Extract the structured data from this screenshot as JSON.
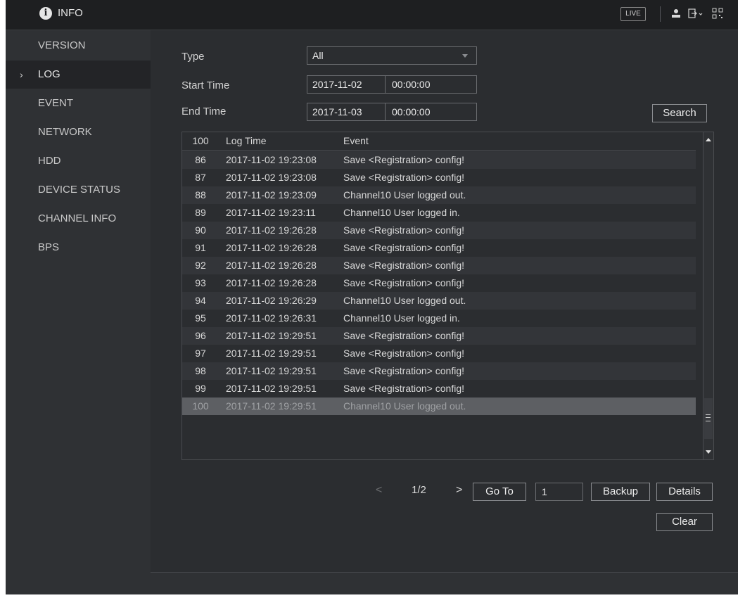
{
  "header": {
    "title": "INFO",
    "live_label": "LIVE"
  },
  "sidebar": {
    "items": [
      {
        "label": "VERSION"
      },
      {
        "label": "LOG"
      },
      {
        "label": "EVENT"
      },
      {
        "label": "NETWORK"
      },
      {
        "label": "HDD"
      },
      {
        "label": "DEVICE STATUS"
      },
      {
        "label": "CHANNEL INFO"
      },
      {
        "label": "BPS"
      }
    ],
    "active_chevron": "›"
  },
  "filters": {
    "type_label": "Type",
    "type_value": "All",
    "start_label": "Start Time",
    "start_date": "2017-11-02",
    "start_time": "00:00:00",
    "end_label": "End Time",
    "end_date": "2017-11-03",
    "end_time": "00:00:00",
    "search_label": "Search"
  },
  "table": {
    "header": {
      "num": "100",
      "time": "Log Time",
      "event": "Event"
    },
    "rows": [
      {
        "num": "86",
        "time": "2017-11-02 19:23:08",
        "event": "Save <Registration> config!"
      },
      {
        "num": "87",
        "time": "2017-11-02 19:23:08",
        "event": "Save <Registration> config!"
      },
      {
        "num": "88",
        "time": "2017-11-02 19:23:09",
        "event": "Channel10  User logged out."
      },
      {
        "num": "89",
        "time": "2017-11-02 19:23:11",
        "event": "Channel10  User logged in."
      },
      {
        "num": "90",
        "time": "2017-11-02 19:26:28",
        "event": "Save <Registration> config!"
      },
      {
        "num": "91",
        "time": "2017-11-02 19:26:28",
        "event": "Save <Registration> config!"
      },
      {
        "num": "92",
        "time": "2017-11-02 19:26:28",
        "event": "Save <Registration> config!"
      },
      {
        "num": "93",
        "time": "2017-11-02 19:26:28",
        "event": "Save <Registration> config!"
      },
      {
        "num": "94",
        "time": "2017-11-02 19:26:29",
        "event": "Channel10  User logged out."
      },
      {
        "num": "95",
        "time": "2017-11-02 19:26:31",
        "event": "Channel10  User logged in."
      },
      {
        "num": "96",
        "time": "2017-11-02 19:29:51",
        "event": "Save <Registration> config!"
      },
      {
        "num": "97",
        "time": "2017-11-02 19:29:51",
        "event": "Save <Registration> config!"
      },
      {
        "num": "98",
        "time": "2017-11-02 19:29:51",
        "event": "Save <Registration> config!"
      },
      {
        "num": "99",
        "time": "2017-11-02 19:29:51",
        "event": "Save <Registration> config!"
      },
      {
        "num": "100",
        "time": "2017-11-02 19:29:51",
        "event": "Channel10  User logged out."
      }
    ]
  },
  "pager": {
    "prev": "<",
    "page": "1/2",
    "next": ">",
    "goto_label": "Go To",
    "goto_value": "1",
    "backup_label": "Backup",
    "details_label": "Details",
    "clear_label": "Clear"
  }
}
